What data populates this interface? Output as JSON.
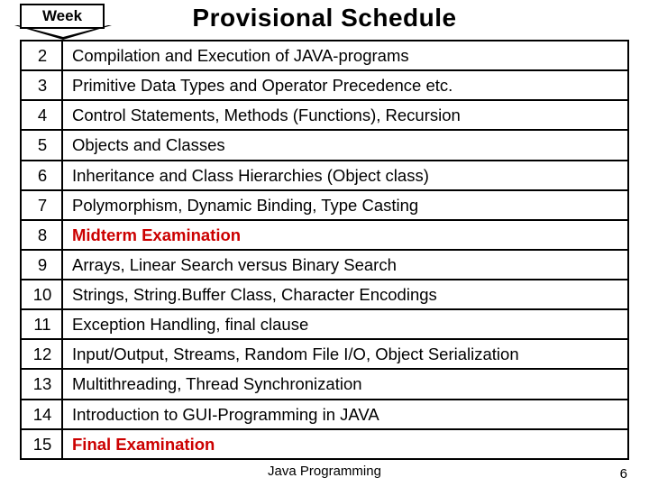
{
  "header": {
    "week_label": "Week",
    "title": "Provisional Schedule"
  },
  "rows": [
    {
      "week": "2",
      "topic": "Compilation and Execution of JAVA-programs",
      "emph": false
    },
    {
      "week": "3",
      "topic": "Primitive Data Types and Operator Precedence etc.",
      "emph": false
    },
    {
      "week": "4",
      "topic": "Control Statements, Methods (Functions), Recursion",
      "emph": false
    },
    {
      "week": "5",
      "topic": "Objects and Classes",
      "emph": false
    },
    {
      "week": "6",
      "topic": "Inheritance and Class Hierarchies (Object class)",
      "emph": false
    },
    {
      "week": "7",
      "topic": "Polymorphism, Dynamic Binding, Type Casting",
      "emph": false
    },
    {
      "week": "8",
      "topic": "Midterm Examination",
      "emph": true
    },
    {
      "week": "9",
      "topic": "Arrays, Linear Search versus Binary Search",
      "emph": false
    },
    {
      "week": "10",
      "topic": "Strings, String.Buffer Class, Character Encodings",
      "emph": false
    },
    {
      "week": "11",
      "topic": "Exception Handling, final clause",
      "emph": false
    },
    {
      "week": "12",
      "topic": "Input/Output, Streams, Random File I/O, Object Serialization",
      "emph": false
    },
    {
      "week": "13",
      "topic": "Multithreading, Thread Synchronization",
      "emph": false
    },
    {
      "week": "14",
      "topic": "Introduction to GUI-Programming in JAVA",
      "emph": false
    },
    {
      "week": "15",
      "topic": "Final Examination",
      "emph": true
    }
  ],
  "footer": {
    "center": "Java Programming",
    "page": "6"
  }
}
